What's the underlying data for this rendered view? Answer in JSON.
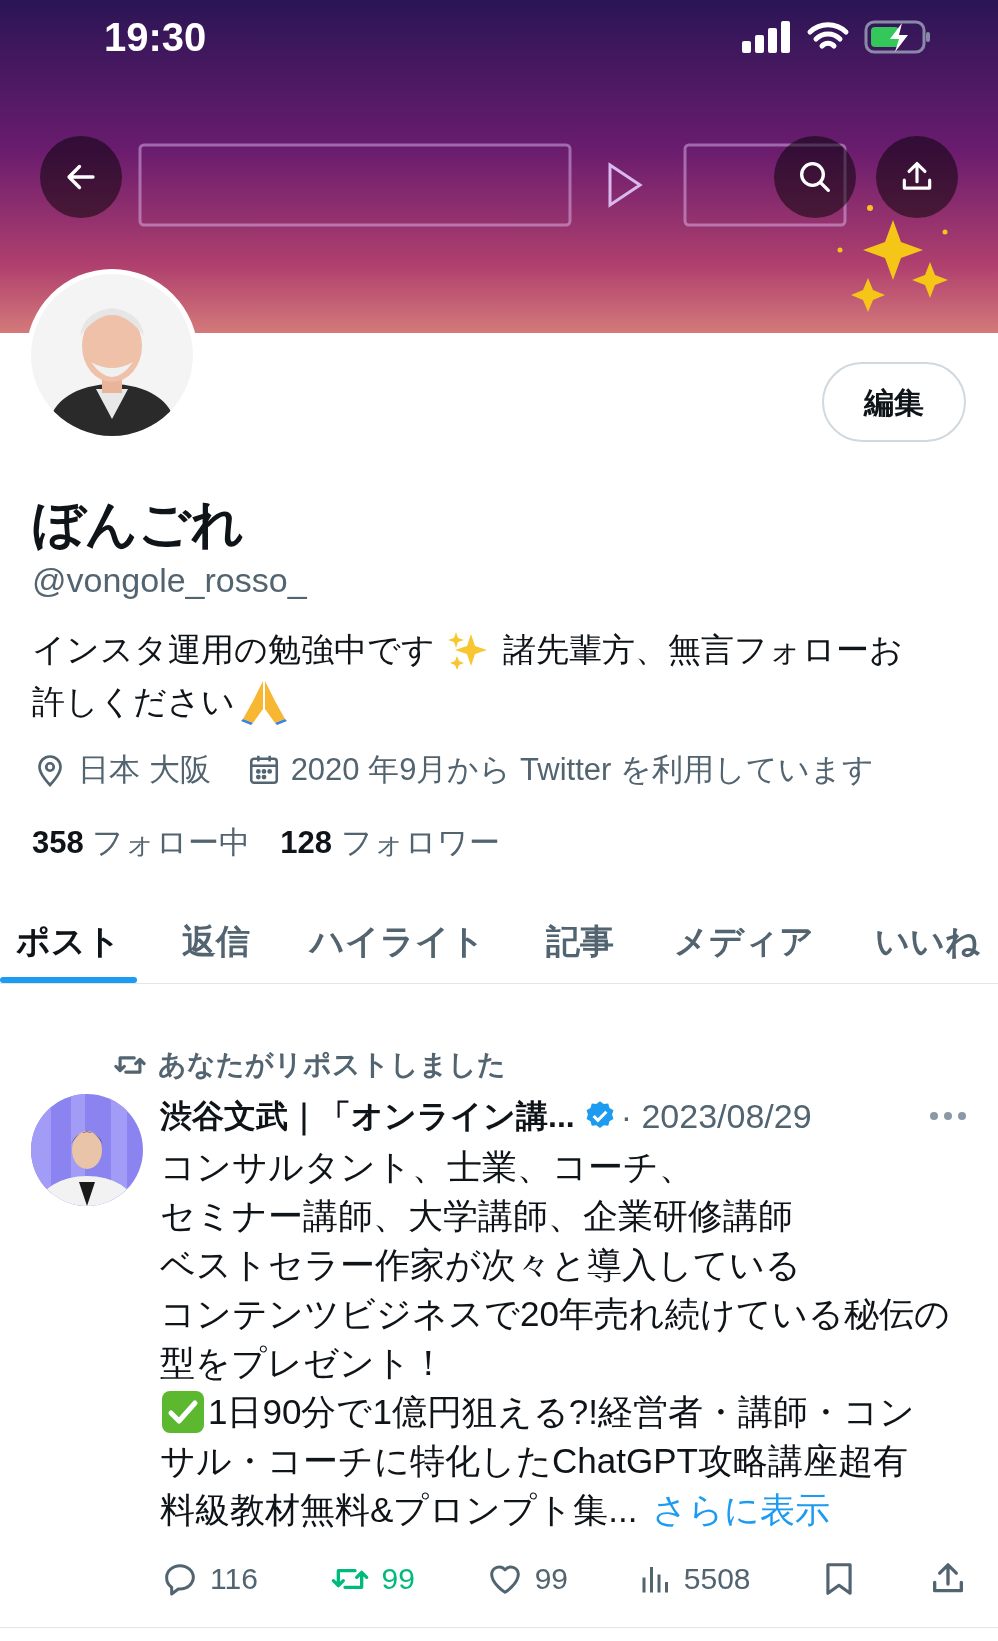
{
  "status_bar": {
    "time": "19:30"
  },
  "profile": {
    "edit_button": "編集",
    "name": "ぼんごれ",
    "handle": "@vongole_rosso_",
    "bio": [
      "インスタ運用の勉強中です",
      "諸先輩方、無言フォローお",
      "許しください"
    ],
    "location": "日本 大阪",
    "joined": "2020 年9月から Twitter を利用しています",
    "stats": [
      {
        "count": "358",
        "label": "フォロー中"
      },
      {
        "count": "128",
        "label": "フォロワー"
      }
    ]
  },
  "tabs": [
    {
      "label": "ポスト",
      "selected": true
    },
    {
      "label": "返信",
      "selected": false
    },
    {
      "label": "ハイライト",
      "selected": false
    },
    {
      "label": "記事",
      "selected": false
    },
    {
      "label": "メディア",
      "selected": false
    },
    {
      "label": "いいね",
      "selected": false
    }
  ],
  "post": {
    "repost_note": "あなたがリポストしました",
    "author": "渋谷文武｜「オンライン講...",
    "verified": true,
    "date": "· 2023/08/29",
    "lines": [
      {
        "text": "コンサルタント、士業、コーチ、",
        "check": false
      },
      {
        "text": "セミナー講師、大学講師、企業研修講師",
        "check": false
      },
      {
        "text": "ベストセラー作家が次々と導入している",
        "check": false
      },
      {
        "text": "コンテンツビジネスで20年売れ続けている秘伝の",
        "check": false
      },
      {
        "text": "型をプレゼント！",
        "check": false
      },
      {
        "text": "1日90分で1億円狙える?!経営者・講師・コン",
        "check": true
      },
      {
        "text": "サル・コーチに特化したChatGPT攻略講座超有",
        "check": false
      },
      {
        "text": "料級教材無料&プロンプト集...",
        "check": false
      }
    ],
    "more_link": "さらに表示",
    "actions": [
      {
        "kind": "reply",
        "count": "116",
        "active": false
      },
      {
        "kind": "repost",
        "count": "99",
        "active": true
      },
      {
        "kind": "like",
        "count": "99",
        "active": false
      },
      {
        "kind": "views",
        "count": "5508",
        "active": false
      },
      {
        "kind": "bookmark",
        "active": false
      },
      {
        "kind": "share",
        "active": false
      }
    ]
  }
}
